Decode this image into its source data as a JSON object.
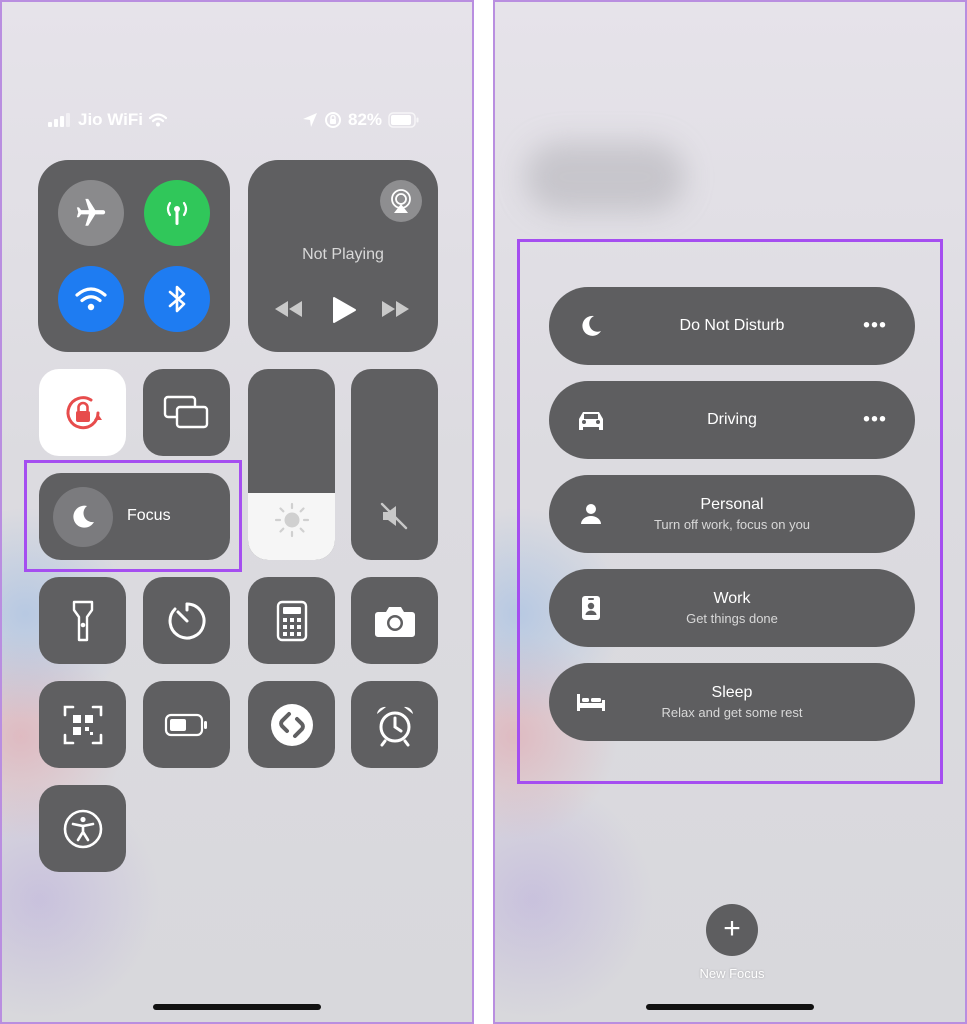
{
  "left": {
    "status": {
      "carrier": "Jio WiFi",
      "battery": "82%"
    },
    "media": {
      "status": "Not Playing"
    },
    "focus": {
      "label": "Focus"
    },
    "brightness_level": 0.35
  },
  "right": {
    "focus_modes": [
      {
        "title": "Do Not Disturb",
        "subtitle": "",
        "icon": "moon-icon",
        "has_more": true
      },
      {
        "title": "Driving",
        "subtitle": "",
        "icon": "car-icon",
        "has_more": true
      },
      {
        "title": "Personal",
        "subtitle": "Turn off work, focus on you",
        "icon": "person-icon",
        "has_more": false
      },
      {
        "title": "Work",
        "subtitle": "Get things done",
        "icon": "id-badge-icon",
        "has_more": false
      },
      {
        "title": "Sleep",
        "subtitle": "Relax and get some rest",
        "icon": "bed-icon",
        "has_more": false
      }
    ],
    "more_symbol": "•••",
    "new_focus": {
      "symbol": "+",
      "label": "New Focus"
    }
  },
  "colors": {
    "highlight": "#a54ef0",
    "green": "#30c75a",
    "blue": "#1e7cf2",
    "tile": "#5f5f61",
    "lock_red": "#e74c4c"
  }
}
